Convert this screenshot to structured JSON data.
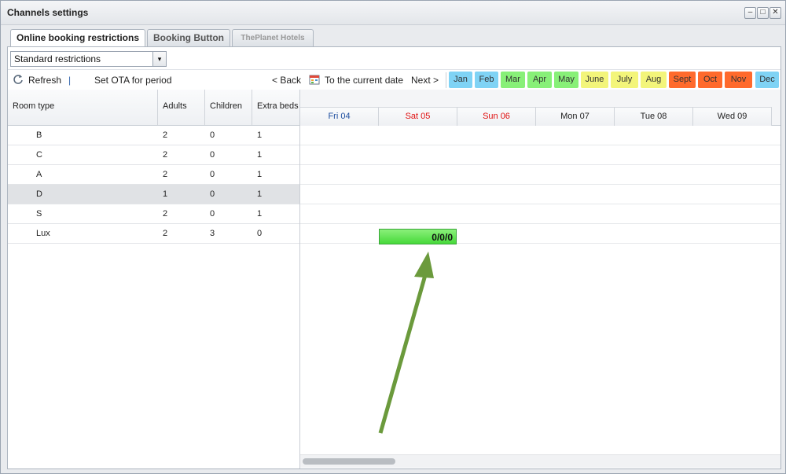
{
  "window": {
    "title": "Channels settings",
    "min_label": "–",
    "max_label": "□",
    "close_label": "✕"
  },
  "tabs": [
    {
      "label": "Online booking restrictions"
    },
    {
      "label": "Booking Button"
    },
    {
      "label": "ThePlanet Hotels"
    }
  ],
  "select": {
    "value": "Standard restrictions",
    "arrow": "▾"
  },
  "toolbar": {
    "refresh": "Refresh",
    "separator": "|",
    "set_ota": "Set OTA for period",
    "back": "< Back",
    "current_date": "To the current date",
    "next": "Next >"
  },
  "months": [
    {
      "label": "Jan",
      "color": "#7fd3f5"
    },
    {
      "label": "Feb",
      "color": "#7fd3f5"
    },
    {
      "label": "Mar",
      "color": "#88f078"
    },
    {
      "label": "Apr",
      "color": "#88f078"
    },
    {
      "label": "May",
      "color": "#88f078"
    },
    {
      "label": "June",
      "color": "#f3f57a"
    },
    {
      "label": "July",
      "color": "#f3f57a"
    },
    {
      "label": "Aug",
      "color": "#f3f57a"
    },
    {
      "label": "Sept",
      "color": "#ff6a2c"
    },
    {
      "label": "Oct",
      "color": "#ff6a2c"
    },
    {
      "label": "Nov",
      "color": "#ff6a2c"
    },
    {
      "label": "Dec",
      "color": "#7fd3f5"
    }
  ],
  "columns": {
    "room_type": "Room type",
    "adults": "Adults",
    "children": "Children",
    "extra_beds": "Extra beds"
  },
  "rows": [
    {
      "room": "B",
      "adults": "2",
      "children": "0",
      "extra": "1"
    },
    {
      "room": "C",
      "adults": "2",
      "children": "0",
      "extra": "1"
    },
    {
      "room": "A",
      "adults": "2",
      "children": "0",
      "extra": "1"
    },
    {
      "room": "D",
      "adults": "1",
      "children": "0",
      "extra": "1"
    },
    {
      "room": "S",
      "adults": "2",
      "children": "0",
      "extra": "1"
    },
    {
      "room": "Lux",
      "adults": "2",
      "children": "3",
      "extra": "0"
    }
  ],
  "days": [
    {
      "label": "Fri 04",
      "color": "#1f4fa0"
    },
    {
      "label": "Sat 05",
      "color": "#e01010"
    },
    {
      "label": "Sun 06",
      "color": "#e01010"
    },
    {
      "label": "Mon 07",
      "color": "#222222"
    },
    {
      "label": "Tue 08",
      "color": "#222222"
    },
    {
      "label": "Wed 09",
      "color": "#222222"
    }
  ],
  "restriction_cell": {
    "value": "0/0/0"
  },
  "colors": {
    "arrow": "#6b9a3c",
    "cell_green": "#47d93a"
  }
}
